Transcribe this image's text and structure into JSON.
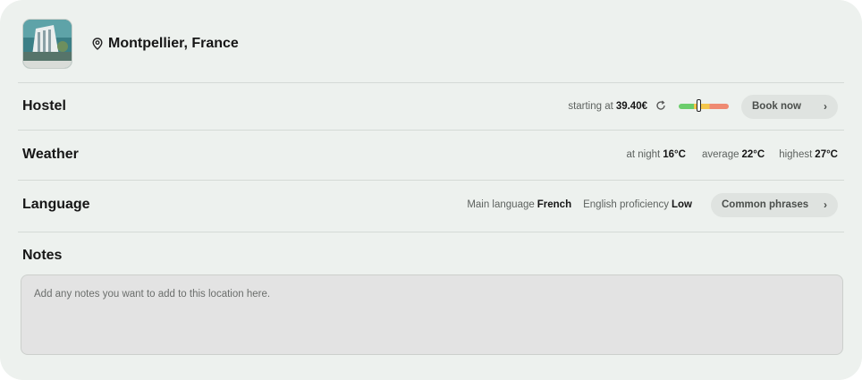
{
  "location": {
    "name": "Montpellier, France",
    "image_icon": "hotel-building-photo",
    "pin_icon": "map-pin-icon"
  },
  "hostel": {
    "title": "Hostel",
    "starting_label": "starting at",
    "price": "39.40€",
    "refresh_icon": "refresh-icon",
    "price_level_fraction": 0.4,
    "book_label": "Book now"
  },
  "weather": {
    "title": "Weather",
    "night_label": "at night",
    "night_value": "16°C",
    "average_label": "average",
    "average_value": "22°C",
    "highest_label": "highest",
    "highest_value": "27°C"
  },
  "language": {
    "title": "Language",
    "main_label": "Main language",
    "main_value": "French",
    "english_label": "English proficiency",
    "english_value": "Low",
    "phrases_label": "Common phrases"
  },
  "notes": {
    "title": "Notes",
    "placeholder": "Add any notes you want to add to this location here."
  },
  "colors": {
    "card_bg": "#edf1ee",
    "gauge_green": "#6bcd6b",
    "gauge_yellow": "#f4c64a",
    "gauge_red": "#ef8a72"
  }
}
